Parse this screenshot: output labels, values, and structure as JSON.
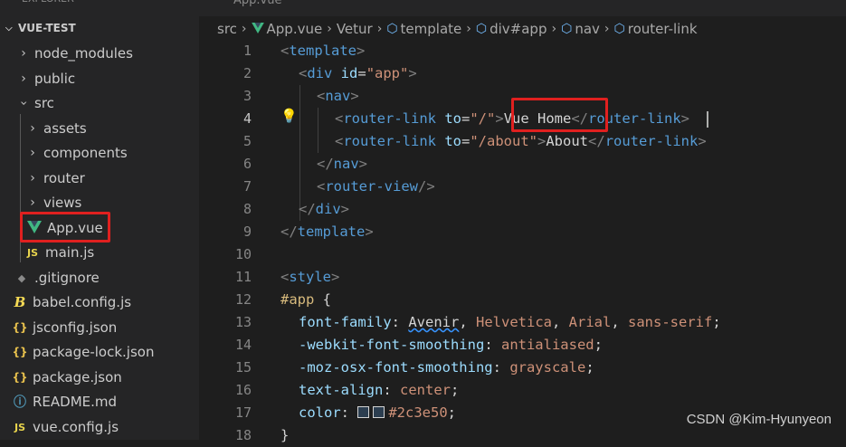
{
  "top_tab_label": "App.vue",
  "explorer": {
    "header": "VUE-TEST",
    "items": [
      {
        "label": "node_modules",
        "kind": "folder",
        "expanded": false
      },
      {
        "label": "public",
        "kind": "folder",
        "expanded": false
      },
      {
        "label": "src",
        "kind": "folder",
        "expanded": true
      },
      {
        "label": "assets",
        "kind": "folder",
        "expanded": false
      },
      {
        "label": "components",
        "kind": "folder",
        "expanded": false
      },
      {
        "label": "router",
        "kind": "folder",
        "expanded": false
      },
      {
        "label": "views",
        "kind": "folder",
        "expanded": false
      },
      {
        "label": "App.vue",
        "kind": "vue",
        "selected": true
      },
      {
        "label": "main.js",
        "kind": "js",
        "icon_text": "JS"
      },
      {
        "label": ".gitignore",
        "kind": "git"
      },
      {
        "label": "babel.config.js",
        "kind": "babel",
        "icon_text": "B"
      },
      {
        "label": "jsconfig.json",
        "kind": "json",
        "icon_text": "{}"
      },
      {
        "label": "package-lock.json",
        "kind": "json",
        "icon_text": "{}"
      },
      {
        "label": "package.json",
        "kind": "json",
        "icon_text": "{}"
      },
      {
        "label": "README.md",
        "kind": "info"
      },
      {
        "label": "vue.config.js",
        "kind": "js",
        "icon_text": "JS"
      }
    ]
  },
  "breadcrumb": [
    "src",
    "App.vue",
    "Vetur",
    "template",
    "div#app",
    "nav",
    "router-link"
  ],
  "editor": {
    "line_numbers": [
      "1",
      "2",
      "3",
      "4",
      "5",
      "6",
      "7",
      "8",
      "9",
      "10",
      "11",
      "12",
      "13",
      "14",
      "15",
      "16",
      "17",
      "18"
    ],
    "active_line": "4",
    "lines": {
      "l1": {
        "a": "<",
        "b": "template",
        "c": ">"
      },
      "l2": {
        "a": "<",
        "b": "div",
        "c": " id",
        "d": "=",
        "e": "\"app\"",
        "f": ">"
      },
      "l3": {
        "a": "<",
        "b": "nav",
        "c": ">"
      },
      "l4": {
        "a": "<",
        "b": "router-link",
        "c": " to",
        "d": "=",
        "e": "\"/\"",
        "f": ">",
        "g": "Vue Home",
        "h": "</",
        "i": "router-link",
        "j": ">"
      },
      "l5": {
        "a": "<",
        "b": "router-link",
        "c": " to",
        "d": "=",
        "e": "\"/about\"",
        "f": ">",
        "g": "About",
        "h": "</",
        "i": "router-link",
        "j": ">"
      },
      "l6": {
        "a": "</",
        "b": "nav",
        "c": ">"
      },
      "l7": {
        "a": "<",
        "b": "router-view",
        "c": "/>"
      },
      "l8": {
        "a": "</",
        "b": "div",
        "c": ">"
      },
      "l9": {
        "a": "</",
        "b": "template",
        "c": ">"
      },
      "l11": {
        "a": "<",
        "b": "style",
        "c": ">"
      },
      "l12": {
        "a": "#app",
        "b": " {"
      },
      "l13": {
        "a": "font-family",
        "b": ": ",
        "c": "Avenir",
        "d": ", ",
        "e": "Helvetica",
        "f": ", ",
        "g": "Arial",
        "h": ", ",
        "i": "sans-serif",
        "j": ";"
      },
      "l14": {
        "a": "-webkit-font-smoothing",
        "b": ": ",
        "c": "antialiased",
        "d": ";"
      },
      "l15": {
        "a": "-moz-osx-font-smoothing",
        "b": ": ",
        "c": "grayscale",
        "d": ";"
      },
      "l16": {
        "a": "text-align",
        "b": ": ",
        "c": "center",
        "d": ";"
      },
      "l17": {
        "a": "color",
        "b": ": ",
        "c": "#2c3e50",
        "d": ";"
      },
      "l18": {
        "a": "}"
      }
    }
  },
  "watermark": "CSDN @Kim-Hyunyeon",
  "colors": {
    "highlight": "#e0201f",
    "vue_green": "#41b883",
    "tag_blue": "#569cd6",
    "string_orange": "#ce9178"
  }
}
